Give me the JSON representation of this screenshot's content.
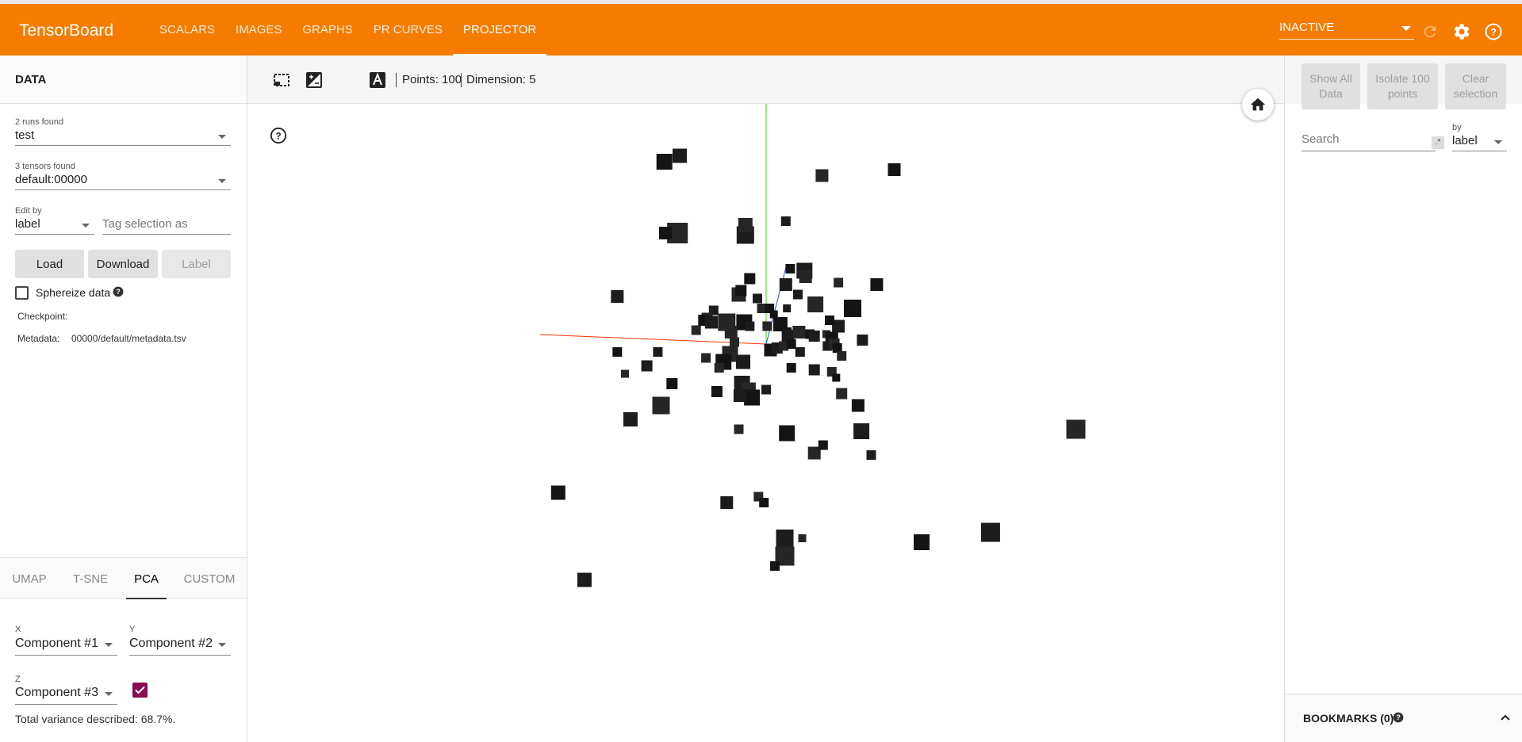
{
  "header": {
    "title": "TensorBoard",
    "tabs": [
      {
        "label": "SCALARS",
        "active": false
      },
      {
        "label": "IMAGES",
        "active": false
      },
      {
        "label": "GRAPHS",
        "active": false
      },
      {
        "label": "PR CURVES",
        "active": false
      },
      {
        "label": "PROJECTOR",
        "active": true
      }
    ],
    "run_selector": "INACTIVE",
    "icons": [
      "refresh-icon",
      "settings-gear-icon",
      "help-icon"
    ],
    "accent_color": "#f57c00"
  },
  "left_panel": {
    "title": "DATA",
    "runs_label": "2 runs found",
    "run_value": "test",
    "tensors_label": "3 tensors found",
    "tensor_value": "default:00000",
    "edit_by_label": "Edit by",
    "edit_by_value": "label",
    "tag_placeholder": "Tag selection as",
    "load_label": "Load",
    "download_label": "Download",
    "label_button": "Label",
    "sphereize_label": "Sphereize data",
    "sphereize_checked": false,
    "checkpoint_label": "Checkpoint:",
    "checkpoint_value": "",
    "metadata_label": "Metadata:",
    "metadata_value": "00000/default/metadata.tsv",
    "projection_tabs": [
      {
        "label": "UMAP",
        "active": false
      },
      {
        "label": "T-SNE",
        "active": false
      },
      {
        "label": "PCA",
        "active": true
      },
      {
        "label": "CUSTOM",
        "active": false
      }
    ],
    "pca": {
      "x_label": "X",
      "x_value": "Component #1",
      "y_label": "Y",
      "y_value": "Component #2",
      "z_label": "Z",
      "z_value": "Component #3",
      "z_enabled": true,
      "variance_text": "Total variance described: 68.7%."
    }
  },
  "toolbar": {
    "icons": [
      "select-rectangle-icon",
      "night-mode-icon",
      "moon-icon",
      "label-text-icon"
    ],
    "points_text": "Points: 100",
    "dimension_text": "Dimension: 5"
  },
  "right_panel": {
    "show_all_label": "Show All Data",
    "isolate_label": "Isolate 100 points",
    "clear_label": "Clear selection",
    "search_placeholder": "Search",
    "regex_label": ".*",
    "by_label": "by",
    "by_value": "label",
    "bookmarks_label": "BOOKMARKS (0)"
  },
  "chart_data": {
    "type": "scatter",
    "title": "",
    "xlabel": "",
    "ylabel": "",
    "point_count": 100,
    "marker": "square-image-sprite",
    "axes_colors": {
      "x": "#ff3300",
      "y": "#33dd00",
      "z": "#2255ff"
    },
    "points": [
      {
        "x": -0.93,
        "y": 0.92,
        "s": 1.0
      },
      {
        "x": -0.79,
        "y": 0.95,
        "s": 0.9
      },
      {
        "x": 0.51,
        "y": 0.85,
        "s": 0.8
      },
      {
        "x": 1.17,
        "y": 0.88,
        "s": 0.8
      },
      {
        "x": 0.18,
        "y": 0.62,
        "s": 0.6
      },
      {
        "x": -0.81,
        "y": 0.56,
        "s": 1.3
      },
      {
        "x": -0.92,
        "y": 0.56,
        "s": 0.8
      },
      {
        "x": -0.19,
        "y": 0.55,
        "s": 1.1
      },
      {
        "x": -0.19,
        "y": 0.6,
        "s": 0.9
      },
      {
        "x": 0.22,
        "y": 0.38,
        "s": 0.6
      },
      {
        "x": 0.35,
        "y": 0.37,
        "s": 1.0
      },
      {
        "x": 0.36,
        "y": 0.34,
        "s": 0.8
      },
      {
        "x": -0.15,
        "y": 0.33,
        "s": 0.7
      },
      {
        "x": 0.18,
        "y": 0.3,
        "s": 0.8
      },
      {
        "x": 0.66,
        "y": 0.31,
        "s": 0.6
      },
      {
        "x": 1.01,
        "y": 0.3,
        "s": 0.8
      },
      {
        "x": -1.36,
        "y": 0.24,
        "s": 0.8
      },
      {
        "x": -0.25,
        "y": 0.25,
        "s": 0.9
      },
      {
        "x": -0.23,
        "y": 0.27,
        "s": 0.7
      },
      {
        "x": -0.08,
        "y": 0.23,
        "s": 0.6
      },
      {
        "x": 0.45,
        "y": 0.2,
        "s": 1.0
      },
      {
        "x": 0.79,
        "y": 0.18,
        "s": 1.1
      },
      {
        "x": 0.19,
        "y": 0.18,
        "s": 0.5
      },
      {
        "x": -0.04,
        "y": 0.18,
        "s": 0.6
      },
      {
        "x": 0.03,
        "y": 0.18,
        "s": 0.6
      },
      {
        "x": -0.48,
        "y": 0.17,
        "s": 0.6
      },
      {
        "x": -0.54,
        "y": 0.13,
        "s": 0.7
      },
      {
        "x": -0.57,
        "y": 0.12,
        "s": 0.7
      },
      {
        "x": -0.5,
        "y": 0.11,
        "s": 0.8
      },
      {
        "x": -0.36,
        "y": 0.11,
        "s": 1.1
      },
      {
        "x": -0.2,
        "y": 0.11,
        "s": 1.0
      },
      {
        "x": -0.15,
        "y": 0.09,
        "s": 0.6
      },
      {
        "x": 0.01,
        "y": 0.09,
        "s": 0.6
      },
      {
        "x": 0.13,
        "y": 0.1,
        "s": 0.9
      },
      {
        "x": 0.66,
        "y": 0.09,
        "s": 0.8
      },
      {
        "x": -0.32,
        "y": 0.06,
        "s": 0.8
      },
      {
        "x": 0.19,
        "y": 0.06,
        "s": 0.6
      },
      {
        "x": 0.2,
        "y": 0.04,
        "s": 0.8
      },
      {
        "x": 0.3,
        "y": 0.06,
        "s": 0.8
      },
      {
        "x": 0.4,
        "y": 0.05,
        "s": 0.6
      },
      {
        "x": 0.44,
        "y": 0.04,
        "s": 0.7
      },
      {
        "x": 0.55,
        "y": 0.05,
        "s": 0.5
      },
      {
        "x": 0.6,
        "y": 0.03,
        "s": 0.8
      },
      {
        "x": 0.88,
        "y": 0.02,
        "s": 0.7
      },
      {
        "x": -0.33,
        "y": -0.05,
        "s": 1.0
      },
      {
        "x": 0.04,
        "y": -0.03,
        "s": 0.8
      },
      {
        "x": 0.1,
        "y": -0.02,
        "s": 0.7
      },
      {
        "x": 0.16,
        "y": -0.01,
        "s": 0.6
      },
      {
        "x": 0.23,
        "y": 0.0,
        "s": 0.6
      },
      {
        "x": 0.56,
        "y": -0.01,
        "s": 0.6
      },
      {
        "x": 0.62,
        "y": 0.0,
        "s": 0.7
      },
      {
        "x": 0.65,
        "y": -0.02,
        "s": 0.6
      },
      {
        "x": 0.31,
        "y": -0.04,
        "s": 0.6
      },
      {
        "x": 0.69,
        "y": -0.06,
        "s": 0.6
      },
      {
        "x": -1.36,
        "y": -0.04,
        "s": 0.6
      },
      {
        "x": -0.99,
        "y": -0.04,
        "s": 0.6
      },
      {
        "x": -0.55,
        "y": -0.07,
        "s": 0.6
      },
      {
        "x": -0.39,
        "y": -0.09,
        "s": 1.0
      },
      {
        "x": -0.21,
        "y": -0.09,
        "s": 0.9
      },
      {
        "x": -0.43,
        "y": -0.12,
        "s": 0.6
      },
      {
        "x": 0.23,
        "y": -0.12,
        "s": 0.6
      },
      {
        "x": 0.44,
        "y": -0.13,
        "s": 0.7
      },
      {
        "x": 0.6,
        "y": -0.14,
        "s": 0.6
      },
      {
        "x": 0.64,
        "y": -0.17,
        "s": 0.5
      },
      {
        "x": -1.09,
        "y": -0.11,
        "s": 0.7
      },
      {
        "x": -1.29,
        "y": -0.15,
        "s": 0.5
      },
      {
        "x": -0.86,
        "y": -0.2,
        "s": 0.7
      },
      {
        "x": -0.22,
        "y": -0.2,
        "s": 1.0
      },
      {
        "x": -0.16,
        "y": -0.23,
        "s": 0.9
      },
      {
        "x": -0.45,
        "y": -0.24,
        "s": 0.7
      },
      {
        "x": 0.0,
        "y": -0.23,
        "s": 0.6
      },
      {
        "x": 0.69,
        "y": -0.25,
        "s": 0.7
      },
      {
        "x": -0.13,
        "y": -0.27,
        "s": 1.0
      },
      {
        "x": -0.24,
        "y": -0.26,
        "s": 0.8
      },
      {
        "x": -0.96,
        "y": -0.31,
        "s": 1.1
      },
      {
        "x": 0.84,
        "y": -0.31,
        "s": 0.8
      },
      {
        "x": -1.24,
        "y": -0.38,
        "s": 0.9
      },
      {
        "x": -0.25,
        "y": -0.43,
        "s": 0.6
      },
      {
        "x": 0.19,
        "y": -0.45,
        "s": 1.0
      },
      {
        "x": 0.87,
        "y": -0.44,
        "s": 1.0
      },
      {
        "x": 0.44,
        "y": -0.55,
        "s": 0.8
      },
      {
        "x": 0.52,
        "y": -0.51,
        "s": 0.6
      },
      {
        "x": 0.96,
        "y": -0.56,
        "s": 0.6
      },
      {
        "x": 2.83,
        "y": -0.43,
        "s": 1.2
      },
      {
        "x": -1.9,
        "y": -0.75,
        "s": 0.9
      },
      {
        "x": -0.36,
        "y": -0.8,
        "s": 0.8
      },
      {
        "x": -0.07,
        "y": -0.77,
        "s": 0.6
      },
      {
        "x": -0.02,
        "y": -0.8,
        "s": 0.6
      },
      {
        "x": 0.17,
        "y": -0.98,
        "s": 1.1
      },
      {
        "x": 0.33,
        "y": -0.98,
        "s": 0.5
      },
      {
        "x": 1.42,
        "y": -1.0,
        "s": 1.0
      },
      {
        "x": 2.05,
        "y": -0.95,
        "s": 1.2
      },
      {
        "x": 0.17,
        "y": -1.07,
        "s": 1.2
      },
      {
        "x": 0.08,
        "y": -1.12,
        "s": 0.6
      },
      {
        "x": -1.66,
        "y": -1.19,
        "s": 0.9
      },
      {
        "x": -0.64,
        "y": 0.07,
        "s": 0.6
      },
      {
        "x": 0.07,
        "y": 0.15,
        "s": 0.5
      },
      {
        "x": 0.29,
        "y": 0.25,
        "s": 0.6
      },
      {
        "x": -0.29,
        "y": 0.01,
        "s": 0.6
      },
      {
        "x": 0.58,
        "y": 0.12,
        "s": 0.6
      }
    ]
  }
}
